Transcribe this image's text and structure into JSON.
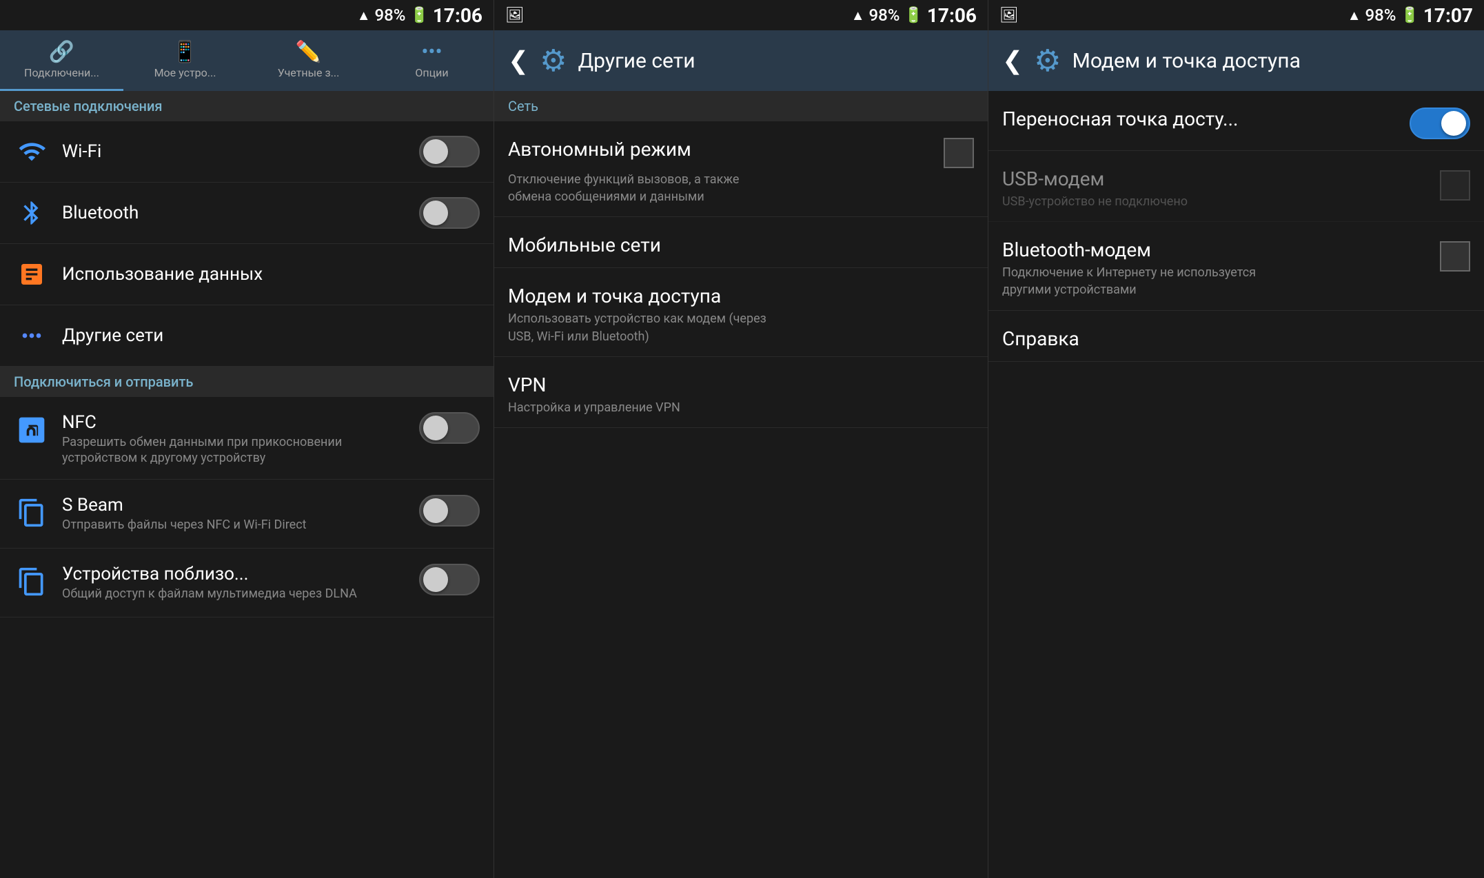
{
  "panels": [
    {
      "id": "panel1",
      "statusBar": {
        "signal": "▲▲▲",
        "battery": "98%",
        "batteryIcon": "🔋",
        "time": "17:06"
      },
      "tabs": [
        {
          "label": "Подключени...",
          "icon": "📶",
          "active": true
        },
        {
          "label": "Мое устро...",
          "icon": "📱",
          "active": false
        },
        {
          "label": "Учетные з...",
          "icon": "✏️",
          "active": false
        },
        {
          "label": "Опции",
          "icon": "···",
          "active": false
        }
      ],
      "sections": [
        {
          "header": "Сетевые подключения",
          "items": [
            {
              "icon": "wifi",
              "iconColor": "#4499ff",
              "title": "Wi-Fi",
              "toggle": true,
              "toggleOn": false
            },
            {
              "icon": "bluetooth",
              "iconColor": "#4499ff",
              "title": "Bluetooth",
              "toggle": true,
              "toggleOn": false
            },
            {
              "icon": "dataUsage",
              "iconColor": "#ff7722",
              "title": "Использование данных",
              "toggle": false
            },
            {
              "icon": "network",
              "iconColor": "#5588ff",
              "title": "Другие сети",
              "toggle": false
            }
          ]
        },
        {
          "header": "Подключиться и отправить",
          "items": [
            {
              "icon": "nfc",
              "iconColor": "#4499ff",
              "title": "NFC",
              "subtitle": "Разрешить обмен данными при прикосновении устройством к другому устройству",
              "toggle": true,
              "toggleOn": false
            },
            {
              "icon": "sbeam",
              "iconColor": "#4499ff",
              "title": "S Beam",
              "subtitle": "Отправить файлы через NFC и Wi-Fi Direct",
              "toggle": true,
              "toggleOn": false
            },
            {
              "icon": "nearby",
              "iconColor": "#4499ff",
              "title": "Устройства поблизо...",
              "subtitle": "Общий доступ к файлам мультимедиа через DLNA",
              "toggle": true,
              "toggleOn": false
            }
          ]
        }
      ]
    },
    {
      "id": "panel2",
      "statusBar": {
        "signal": "▲▲▲",
        "battery": "98%",
        "batteryIcon": "🔋",
        "time": "17:06"
      },
      "header": {
        "back": "❮",
        "icon": "⚙",
        "title": "Другие сети"
      },
      "subHeaders": [
        "Сеть"
      ],
      "items": [
        {
          "title": "Автономный режим",
          "subtitle": "Отключение функций вызовов, а также обмена сообщениями и данными",
          "checkbox": true
        },
        {
          "title": "Мобильные сети",
          "subtitle": "",
          "checkbox": false
        },
        {
          "title": "Модем и точка доступа",
          "subtitle": "Использовать устройство как модем (через USB, Wi-Fi или Bluetooth)",
          "checkbox": false
        },
        {
          "title": "VPN",
          "subtitle": "Настройка и управление VPN",
          "checkbox": false
        }
      ]
    },
    {
      "id": "panel3",
      "statusBar": {
        "signal": "▲▲▲",
        "battery": "98%",
        "batteryIcon": "🔋",
        "time": "17:07"
      },
      "header": {
        "back": "❮",
        "icon": "⚙",
        "title": "Модем и точка доступа"
      },
      "items": [
        {
          "title": "Переносная точка досту...",
          "subtitle": "",
          "toggle": true,
          "toggleOn": true,
          "disabled": false
        },
        {
          "title": "USB-модем",
          "subtitle": "USB-устройство не подключено",
          "toggle": false,
          "checkbox": true,
          "disabled": true
        },
        {
          "title": "Bluetooth-модем",
          "subtitle": "Подключение к Интернету не используется другими устройствами",
          "toggle": false,
          "checkbox": true,
          "disabled": false
        },
        {
          "title": "Справка",
          "subtitle": "",
          "toggle": false,
          "checkbox": false,
          "disabled": false
        }
      ]
    }
  ]
}
